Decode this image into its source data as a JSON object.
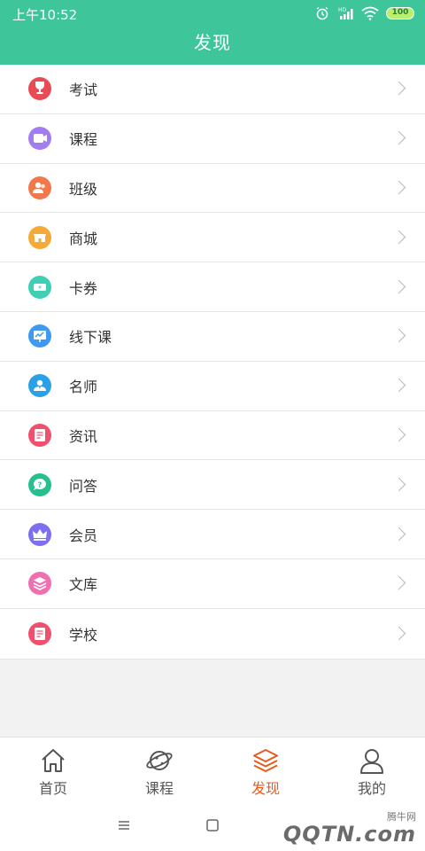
{
  "status": {
    "time": "上午10:52",
    "battery": "100",
    "network_badge": "HD"
  },
  "header": {
    "title": "发现"
  },
  "menu": [
    {
      "label": "考试",
      "icon": "trophy-icon",
      "color": "#e94b55"
    },
    {
      "label": "课程",
      "icon": "video-icon",
      "color": "#a37df0"
    },
    {
      "label": "班级",
      "icon": "users-icon",
      "color": "#f2784b"
    },
    {
      "label": "商城",
      "icon": "store-icon",
      "color": "#f5a936"
    },
    {
      "label": "卡券",
      "icon": "ticket-icon",
      "color": "#3fcfb4"
    },
    {
      "label": "线下课",
      "icon": "board-icon",
      "color": "#3e9af0"
    },
    {
      "label": "名师",
      "icon": "teacher-icon",
      "color": "#2aa1e6"
    },
    {
      "label": "资讯",
      "icon": "news-icon",
      "color": "#f0506e"
    },
    {
      "label": "问答",
      "icon": "question-icon",
      "color": "#25c08e"
    },
    {
      "label": "会员",
      "icon": "crown-icon",
      "color": "#7d6ff0"
    },
    {
      "label": "文库",
      "icon": "layers-icon",
      "color": "#f06fb1"
    },
    {
      "label": "学校",
      "icon": "school-icon",
      "color": "#f0506e"
    }
  ],
  "tabbar": {
    "home": "首页",
    "courses": "课程",
    "discover": "发现",
    "mine": "我的",
    "active_color": "#e8591c"
  },
  "watermark": {
    "small": "腾牛网",
    "big": "QQTN.com"
  },
  "colors": {
    "header": "#3fc59a"
  }
}
